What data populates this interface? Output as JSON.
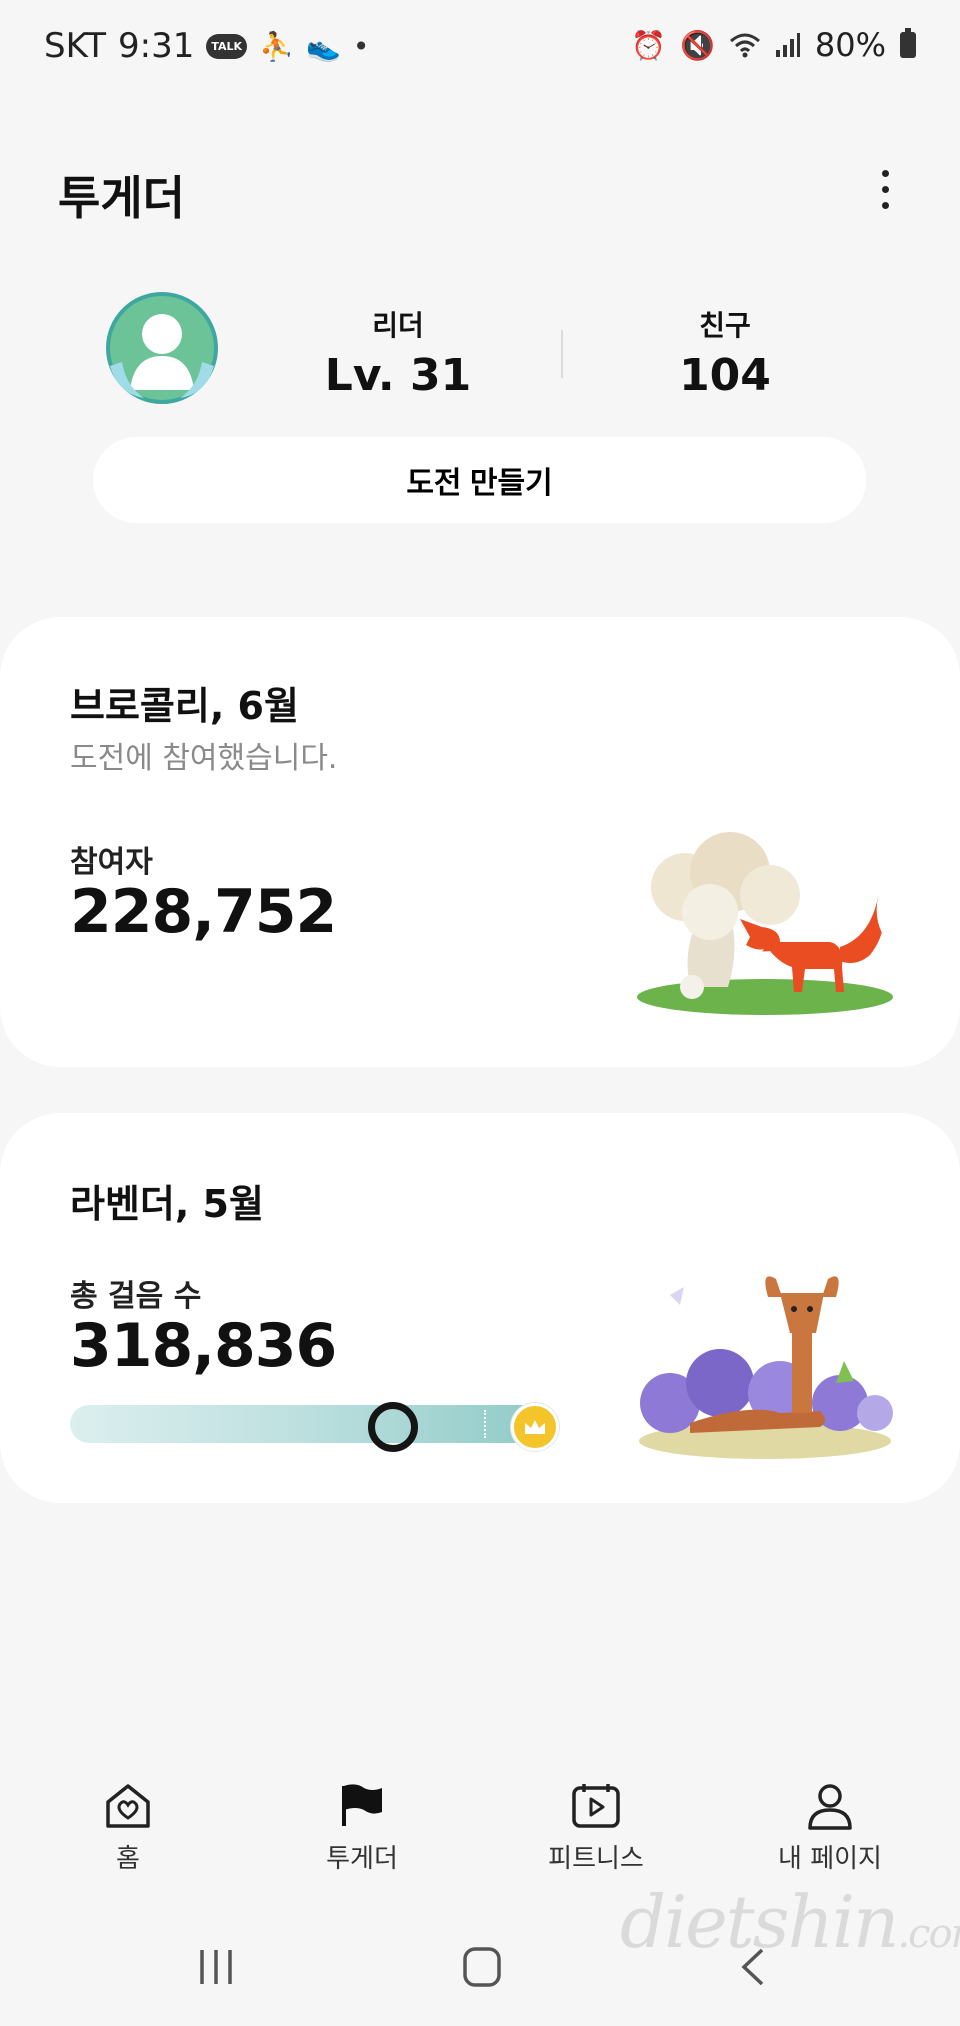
{
  "status_bar": {
    "carrier": "SKT",
    "time": "9:31",
    "talk_label": "TALK",
    "battery": "80%"
  },
  "header": {
    "title": "투게더"
  },
  "profile": {
    "leader_label": "리더",
    "leader_value": "Lv. 31",
    "friends_label": "친구",
    "friends_value": "104"
  },
  "make_challenge_label": "도전 만들기",
  "challenges": [
    {
      "title": "브로콜리, 6월",
      "subtitle": "도전에 참여했습니다.",
      "metric_label": "참여자",
      "metric_value": "228,752"
    },
    {
      "title": "라벤더, 5월",
      "metric_label": "총 걸음 수",
      "metric_value": "318,836",
      "progress": 0.67
    }
  ],
  "bottom_nav": {
    "items": [
      {
        "label": "홈",
        "icon": "home-heart-icon"
      },
      {
        "label": "투게더",
        "icon": "flag-icon"
      },
      {
        "label": "피트니스",
        "icon": "calendar-play-icon"
      },
      {
        "label": "내 페이지",
        "icon": "person-icon"
      }
    ]
  },
  "watermark": {
    "brand": "dietshin",
    "suffix": ".com"
  },
  "colors": {
    "background": "#f6f6f6",
    "card": "#ffffff",
    "progress_teal": "#8fcac7",
    "crown_gold": "#f4c52a",
    "fox_orange": "#ea4d22",
    "grass_green": "#6bb34a",
    "lavender": "#8e7ad6"
  }
}
